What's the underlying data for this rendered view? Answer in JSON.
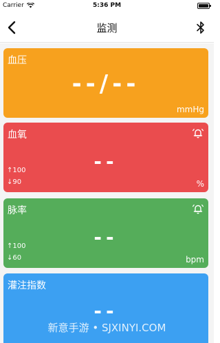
{
  "status_bar": {
    "carrier": "Carrier",
    "time": "5:36 PM"
  },
  "nav": {
    "title": "监测",
    "back_icon": "chevron-left-icon",
    "right_icon": "bluetooth-icon"
  },
  "cards": {
    "bp": {
      "label": "血压",
      "value": "--/--",
      "unit": "mmHg",
      "color": "#f7a11e"
    },
    "spo2": {
      "label": "血氧",
      "value": "--",
      "unit": "%",
      "high": "↑100",
      "low": "↓90",
      "color": "#ea4c4e",
      "alarm_icon": "alarm-bell-icon"
    },
    "pr": {
      "label": "脉率",
      "value": "--",
      "unit": "bpm",
      "high": "↑100",
      "low": "↓60",
      "color": "#55ad5a",
      "alarm_icon": "alarm-bell-icon"
    },
    "pi": {
      "label": "灌注指数",
      "value": "--",
      "color": "#3ca0f2"
    }
  },
  "watermark": "新意手游 • SJXINYI.COM"
}
